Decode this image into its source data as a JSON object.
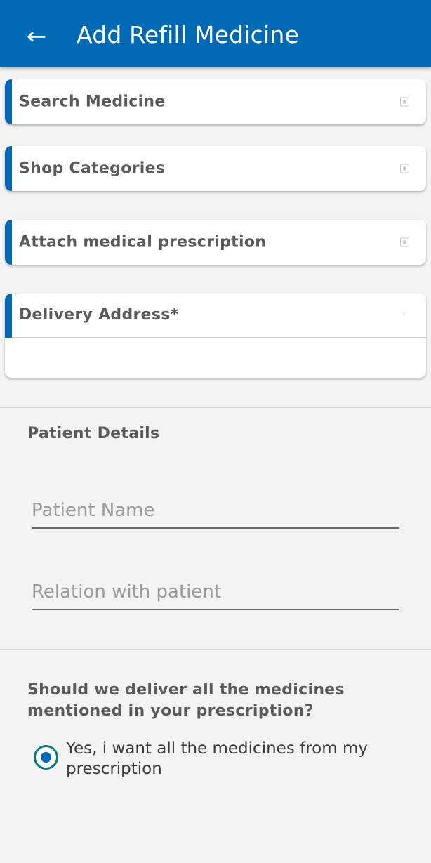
{
  "appbar": {
    "back_icon": "arrow-left-icon",
    "title": "Add Refill Medicine",
    "color": "#0069b4"
  },
  "cards": {
    "search": {
      "label": "Search Medicine",
      "icon": "expand-square-icon"
    },
    "categories": {
      "label": "Shop Categories",
      "icon": "expand-square-icon"
    },
    "prescription": {
      "label": "Attach medical prescription",
      "icon": "expand-square-icon"
    },
    "address": {
      "label": "Delivery Address*",
      "icon": "chevron-right-icon",
      "value": ""
    }
  },
  "patient": {
    "title": "Patient Details",
    "name_placeholder": "Patient Name",
    "relation_placeholder": "Relation with patient"
  },
  "delivery_question": {
    "text": "Should we deliver all the medicines mentioned in your prescription?",
    "option_label": "Yes, i want all the medicines from my prescription",
    "selected": true
  }
}
